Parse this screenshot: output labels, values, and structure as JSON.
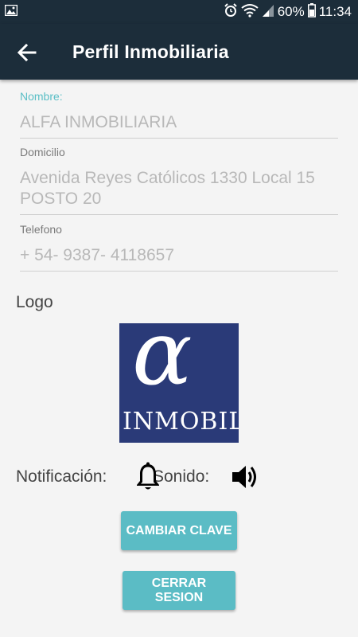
{
  "status_bar": {
    "gallery_icon": "image-icon",
    "alarm_icon": "alarm-icon",
    "wifi_icon": "wifi-icon",
    "signal_icon": "signal-icon",
    "battery_text": "60%",
    "battery_icon": "battery-icon",
    "time": "11:34"
  },
  "app_bar": {
    "back_icon": "arrow-back-icon",
    "title": "Perfil Inmobiliaria"
  },
  "form": {
    "nombre": {
      "label": "Nombre:",
      "value": "ALFA INMOBILIARIA"
    },
    "domicilio": {
      "label": "Domicilio",
      "value": "Avenida Reyes Católicos 1330 Local 15 POSTO 20"
    },
    "telefono": {
      "label": "Telefono",
      "value": "+ 54- 9387- 4118657"
    }
  },
  "logo": {
    "label": "Logo",
    "image_text": "INMOBIL"
  },
  "settings": {
    "notificacion_label": "Notificación:",
    "notificacion_icon": "bell-icon",
    "sonido_label": "Sonido:",
    "sonido_icon": "volume-icon"
  },
  "buttons": {
    "cambiar_clave": "CAMBIAR CLAVE",
    "cerrar_sesion": "CERRAR SESION"
  },
  "colors": {
    "app_bar": "#1c2d3a",
    "accent": "#5bbfc6",
    "button": "#5bbcc5",
    "logo_background": "#2a3a78"
  }
}
